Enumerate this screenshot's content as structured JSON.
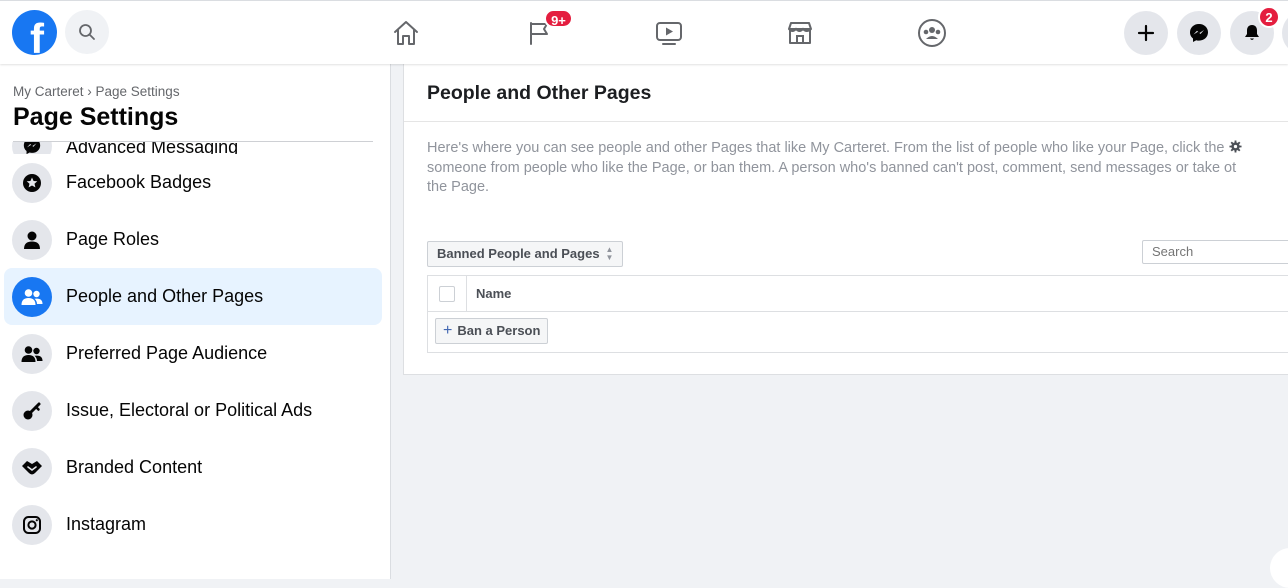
{
  "topbar": {
    "logo_letter": "f",
    "watch_badge": "9+",
    "notifications_badge": "2"
  },
  "sidebar": {
    "breadcrumb": "My Carteret › Page Settings",
    "title": "Page Settings",
    "items": [
      {
        "label": "Advanced Messaging",
        "icon": "messenger-icon"
      },
      {
        "label": "Facebook Badges",
        "icon": "badge-star-icon"
      },
      {
        "label": "Page Roles",
        "icon": "person-icon"
      },
      {
        "label": "People and Other Pages",
        "icon": "people-icon",
        "active": true
      },
      {
        "label": "Preferred Page Audience",
        "icon": "audience-icon"
      },
      {
        "label": "Issue, Electoral or Political Ads",
        "icon": "key-icon"
      },
      {
        "label": "Branded Content",
        "icon": "handshake-icon"
      },
      {
        "label": "Instagram",
        "icon": "instagram-icon"
      }
    ]
  },
  "main": {
    "title": "People and Other Pages",
    "description_lines": [
      "Here's where you can see people and other Pages that like My Carteret. From the list of people who like your Page, click the",
      "someone from people who like the Page, or ban them. A person who's banned can't post, comment, send messages or take ot",
      "the Page."
    ],
    "filter_select": "Banned People and Pages",
    "search_placeholder": "Search",
    "table": {
      "columns": [
        "Name"
      ]
    },
    "ban_button": "Ban a Person"
  },
  "colors": {
    "brand": "#1877f2",
    "badge": "#e41e3f",
    "active_bg": "#e7f3ff"
  }
}
